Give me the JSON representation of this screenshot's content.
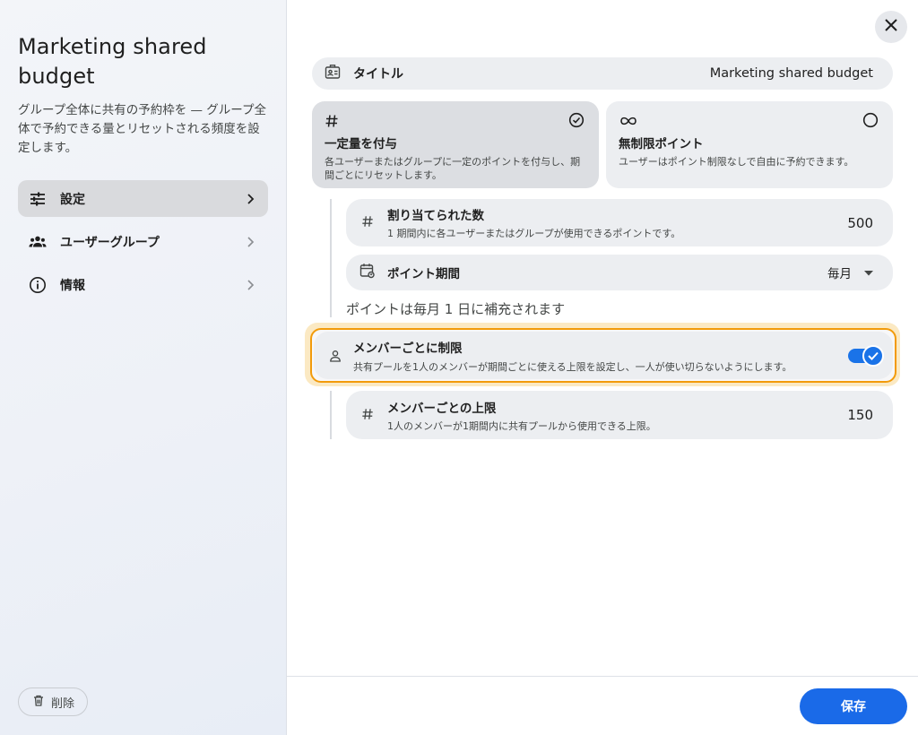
{
  "sidebar": {
    "title": "Marketing shared budget",
    "description": "グループ全体に共有の予約枠を — グループ全体で予約できる量とリセットされる頻度を設定します。",
    "items": [
      {
        "label": "設定",
        "icon": "tune-icon",
        "active": true
      },
      {
        "label": "ユーザーグループ",
        "icon": "groups-icon",
        "active": false
      },
      {
        "label": "情報",
        "icon": "info-icon",
        "active": false
      }
    ],
    "delete_label": "削除"
  },
  "main": {
    "title_label": "タイトル",
    "title_value": "Marketing shared budget",
    "modes": [
      {
        "title": "一定量を付与",
        "desc": "各ユーザーまたはグループに一定のポイントを付与し、期間ごとにリセットします。",
        "selected": true,
        "icon": "hash-icon"
      },
      {
        "title": "無制限ポイント",
        "desc": "ユーザーはポイント制限なしで自由に予約できます。",
        "selected": false,
        "icon": "infinity-icon"
      }
    ],
    "allocated": {
      "title": "割り当てられた数",
      "desc": "1 期間内に各ユーザーまたはグループが使用できるポイントです。",
      "value": "500"
    },
    "period": {
      "title": "ポイント期間",
      "value": "毎月"
    },
    "refill_note": "ポイントは毎月 1 日に補充されます",
    "per_member_limit": {
      "title": "メンバーごとに制限",
      "desc": "共有プールを1人のメンバーが期間ごとに使える上限を設定し、一人が使い切らないようにします。",
      "enabled": true
    },
    "per_member_max": {
      "title": "メンバーごとの上限",
      "desc": "1人のメンバーが1期間内に共有プールから使用できる上限。",
      "value": "150"
    },
    "save_label": "保存"
  },
  "colors": {
    "accent": "#1a73e8",
    "highlight": "#f29b0b"
  }
}
